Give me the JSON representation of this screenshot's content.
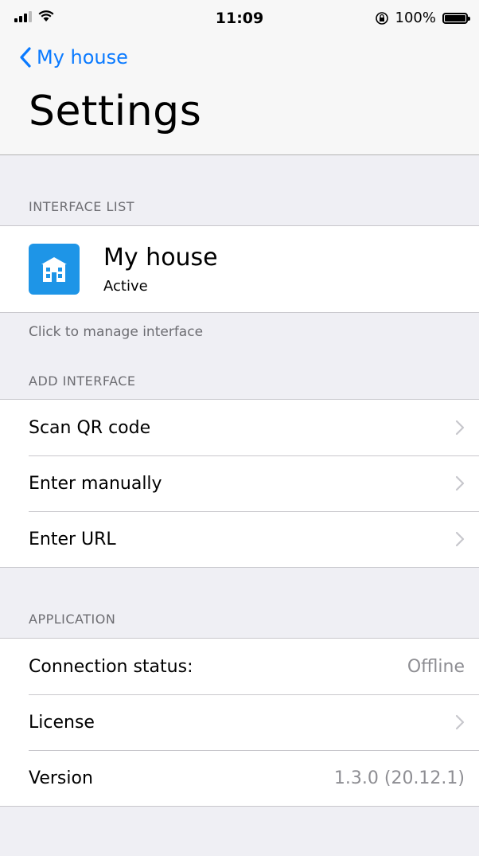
{
  "status_bar": {
    "time": "11:09",
    "battery_percent": "100%",
    "icons": [
      "signal-icon",
      "wifi-icon",
      "orientation-lock-icon",
      "battery-icon"
    ]
  },
  "nav": {
    "back_label": "My house",
    "title": "Settings",
    "accent_color": "#0a7aff"
  },
  "interface_list": {
    "header": "INTERFACE LIST",
    "item": {
      "name": "My house",
      "status": "Active",
      "icon": "house-icon",
      "icon_color": "#1e95e7"
    },
    "footer": "Click to manage interface"
  },
  "add_interface": {
    "header": "ADD INTERFACE",
    "items": [
      {
        "label": "Scan QR code"
      },
      {
        "label": "Enter manually"
      },
      {
        "label": "Enter URL"
      }
    ]
  },
  "application": {
    "header": "APPLICATION",
    "connection_label": "Connection status:",
    "connection_value": "Offline",
    "license_label": "License",
    "version_label": "Version",
    "version_value": "1.3.0 (20.12.1)"
  }
}
